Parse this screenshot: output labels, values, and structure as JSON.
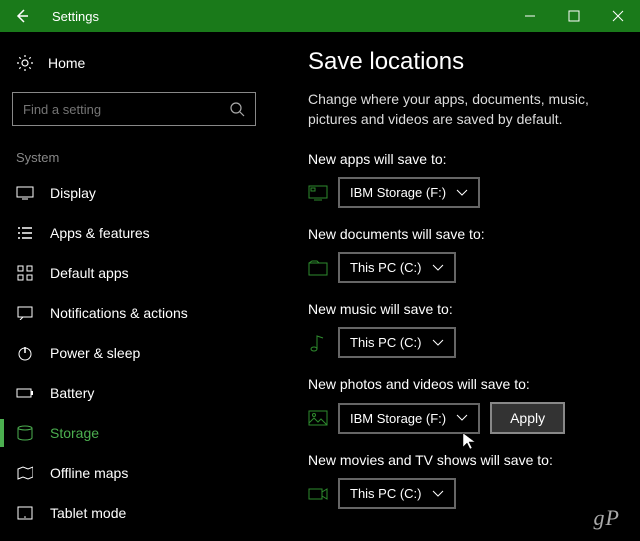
{
  "window": {
    "title": "Settings"
  },
  "sidebar": {
    "home": "Home",
    "search_placeholder": "Find a setting",
    "section": "System",
    "items": [
      {
        "label": "Display"
      },
      {
        "label": "Apps & features"
      },
      {
        "label": "Default apps"
      },
      {
        "label": "Notifications & actions"
      },
      {
        "label": "Power & sleep"
      },
      {
        "label": "Battery"
      },
      {
        "label": "Storage"
      },
      {
        "label": "Offline maps"
      },
      {
        "label": "Tablet mode"
      }
    ]
  },
  "page": {
    "title": "Save locations",
    "description": "Change where your apps, documents, music, pictures and videos are saved by default."
  },
  "settings": [
    {
      "label": "New apps will save to:",
      "value": "IBM Storage (F:)"
    },
    {
      "label": "New documents will save to:",
      "value": "This PC (C:)"
    },
    {
      "label": "New music will save to:",
      "value": "This PC (C:)"
    },
    {
      "label": "New photos and videos will save to:",
      "value": "IBM Storage (F:)",
      "apply": "Apply"
    },
    {
      "label": "New movies and TV shows will save to:",
      "value": "This PC (C:)"
    }
  ],
  "watermark": "gP"
}
